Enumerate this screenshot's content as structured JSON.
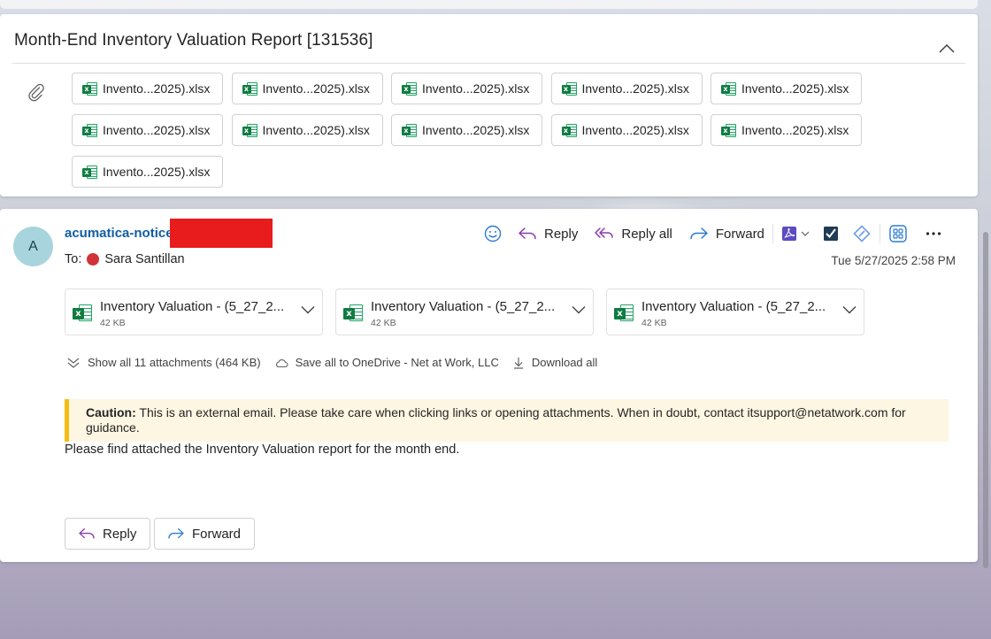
{
  "thread": {
    "title": "Month-End Inventory Valuation Report [131536]",
    "attachment_chips": [
      "Invento...2025).xlsx",
      "Invento...2025).xlsx",
      "Invento...2025).xlsx",
      "Invento...2025).xlsx",
      "Invento...2025).xlsx",
      "Invento...2025).xlsx",
      "Invento...2025).xlsx",
      "Invento...2025).xlsx",
      "Invento...2025).xlsx",
      "Invento...2025).xlsx",
      "Invento...2025).xlsx"
    ]
  },
  "message": {
    "avatar_initial": "A",
    "sender": "acumatica-notice",
    "to_label": "To:",
    "recipient": "Sara Santillan",
    "date": "Tue 5/27/2025 2:58 PM",
    "actions": {
      "reply": "Reply",
      "reply_all": "Reply all",
      "forward": "Forward"
    },
    "attachments": [
      {
        "name": "Inventory Valuation - (5_27_2...",
        "size": "42 KB"
      },
      {
        "name": "Inventory Valuation - (5_27_2...",
        "size": "42 KB"
      },
      {
        "name": "Inventory Valuation - (5_27_2...",
        "size": "42 KB"
      }
    ],
    "attachment_links": {
      "show_all": "Show all 11 attachments (464 KB)",
      "save_onedrive": "Save all to OneDrive - Net at Work, LLC",
      "download_all": "Download all"
    },
    "caution_label": "Caution:",
    "caution_text": " This is an external email. Please take care when clicking links or opening attachments. When in doubt, contact itsupport@netatwork.com for guidance.",
    "body": "Please find attached the Inventory Valuation report for the month end.",
    "bottom": {
      "reply": "Reply",
      "forward": "Forward"
    }
  },
  "colors": {
    "sender_link": "#115ea3",
    "caution_bar": "#f5bd0f",
    "caution_bg": "#fdf6e3",
    "excel_green": "#107c41",
    "presence_busy": "#d13438",
    "reply_purple": "#8a3ca8",
    "forward_blue": "#2e7bcf"
  }
}
